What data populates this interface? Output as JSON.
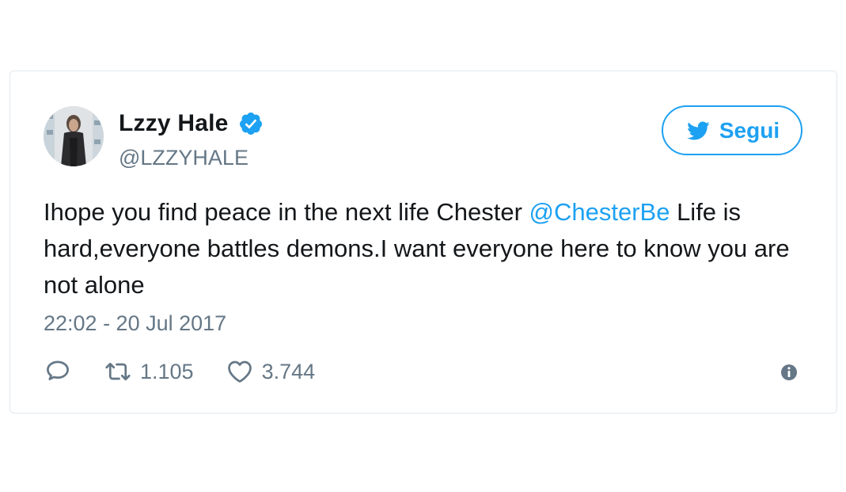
{
  "author": {
    "display_name": "Lzzy Hale",
    "handle": "@LZZYHALE",
    "verified_icon": "verified-badge-icon",
    "avatar_icon": "avatar-photo"
  },
  "follow_button": {
    "label": "Segui",
    "icon": "twitter-bird-icon"
  },
  "tweet": {
    "text_part1": "Ihope you find peace in the next life Chester ",
    "mention": "@ChesterBe",
    "text_part2": " Life is hard,everyone battles demons.I want everyone here to know you are not alone",
    "timestamp": "22:02 - 20 Jul 2017"
  },
  "actions": {
    "reply_icon": "reply-icon",
    "retweet_count": "1.105",
    "like_count": "3.744",
    "info_icon": "info-icon"
  },
  "colors": {
    "accent": "#1da1f2",
    "secondary_text": "#657786",
    "primary_text": "#14171a",
    "border": "#e1e8ed"
  }
}
